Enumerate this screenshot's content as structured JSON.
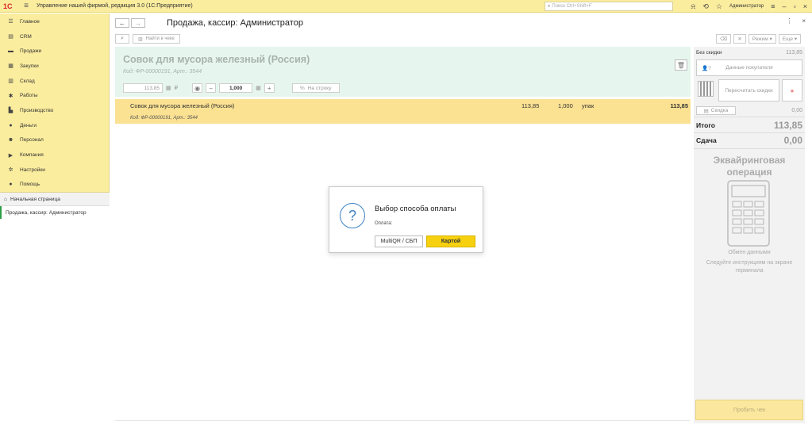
{
  "titlebar": {
    "logo": "1С",
    "title": "Управление нашей фирмой, редакция 3.0  (1С:Предприятие)",
    "search_placeholder": "Поиск Ctrl+Shift+F",
    "user": "Администратор"
  },
  "sidebar": {
    "items": [
      {
        "label": "Главное",
        "icon": "menu-icon"
      },
      {
        "label": "CRM",
        "icon": "crm-icon"
      },
      {
        "label": "Продажи",
        "icon": "cart-icon"
      },
      {
        "label": "Закупки",
        "icon": "purchase-icon"
      },
      {
        "label": "Склад",
        "icon": "warehouse-icon"
      },
      {
        "label": "Работы",
        "icon": "tools-icon"
      },
      {
        "label": "Производство",
        "icon": "factory-icon"
      },
      {
        "label": "Деньги",
        "icon": "money-icon"
      },
      {
        "label": "Персонал",
        "icon": "people-icon"
      },
      {
        "label": "Компания",
        "icon": "flag-icon"
      },
      {
        "label": "Настройки",
        "icon": "gear-icon"
      },
      {
        "label": "Помощь",
        "icon": "help-icon"
      }
    ],
    "home": "Начальная страница",
    "open_tab": "Продажа, кассир: Администратор"
  },
  "header": {
    "title": "Продажа, кассир: Администратор"
  },
  "toolbar": {
    "find_in_receipt": "Найти в чеке",
    "mode": "Режим",
    "more": "Еще"
  },
  "product": {
    "name": "Совок для мусора железный (Россия)",
    "code": "Код: ФР-00000191, Арт.: 3544",
    "price": "113,85",
    "currency": "₽",
    "quantity": "1,000",
    "to_line": "На строку"
  },
  "receipt_row": {
    "name": "Совок для мусора железный (Россия)",
    "code": "Код: ФР-00000191, Арт.: 3544",
    "price": "113,85",
    "quantity": "1,000",
    "unit": "упак",
    "sum": "113,85"
  },
  "right_panel": {
    "no_discount_label": "Без скидки",
    "no_discount_value": "113,85",
    "buyer_data": "Данные покупателя",
    "recalc_discounts": "Пересчитать скидки",
    "discount_btn": "Скидка",
    "discount_value": "0,00",
    "total_label": "Итого",
    "total_value": "113,85",
    "change_label": "Сдача",
    "change_value": "0,00",
    "acquiring_title": "Эквайринговая операция",
    "exchange_text": "Обмен данными",
    "instruction_text": "Следуйте инструкциям на экране терминала",
    "print_receipt": "Пробить чек"
  },
  "dialog": {
    "title": "Выбор способа оплаты",
    "text": "Оплата:",
    "btn_multiqr": "MultiQR / СБП",
    "btn_card": "Картой"
  }
}
